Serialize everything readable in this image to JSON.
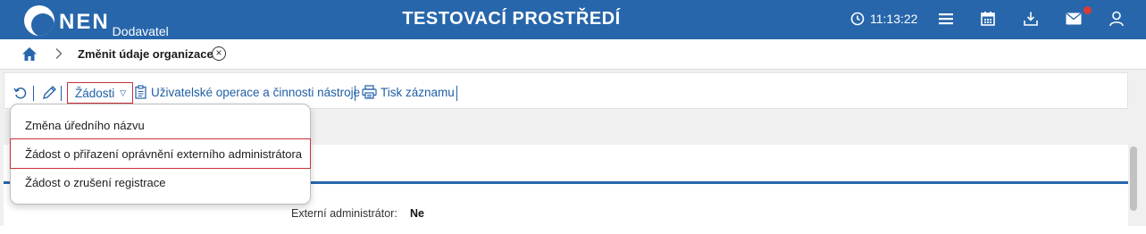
{
  "header": {
    "logo_text": "NEN",
    "logo_subtitle": "Dodavatel",
    "environment_title": "TESTOVACÍ PROSTŘEDÍ",
    "clock_time": "11:13:22",
    "icons": [
      "menu-icon",
      "calendar-icon",
      "download-icon",
      "mail-icon",
      "user-icon"
    ]
  },
  "breadcrumb": {
    "current_page": "Změnit údaje organizace"
  },
  "toolbar": {
    "requests_label": "Žádosti",
    "user_operations_label": "Uživatelské operace a činnosti nástroje",
    "print_label": "Tisk záznamu"
  },
  "requests_menu": {
    "items": [
      {
        "label": "Změna úředního názvu"
      },
      {
        "label": "Žádost o přiřazení oprávnění externího administrátora"
      },
      {
        "label": "Žádost o zrušení registrace"
      }
    ]
  },
  "form": {
    "external_admin_label": "Externí administrátor:",
    "external_admin_value": "Ne"
  },
  "colors": {
    "brand_blue": "#2766ab",
    "highlight_red": "#c9303a",
    "notification_dot": "#d93a3a"
  }
}
